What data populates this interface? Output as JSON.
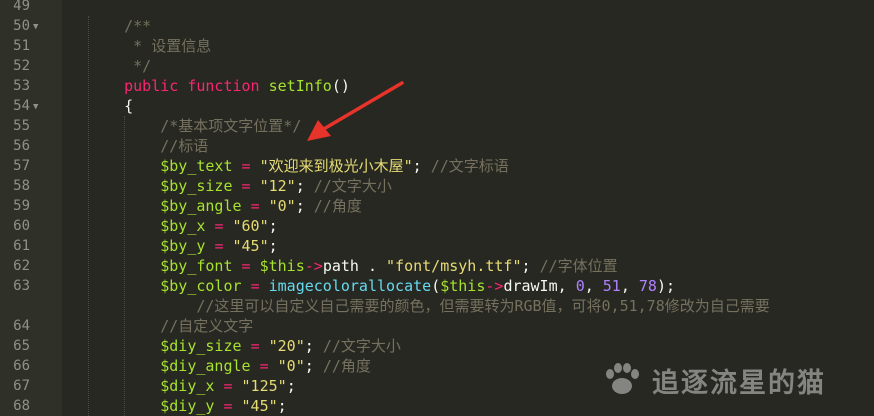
{
  "lines": [
    {
      "n": "49",
      "fold": false,
      "wrapped": false,
      "tokens": []
    },
    {
      "n": "50",
      "fold": true,
      "wrapped": false,
      "tokens": [
        {
          "t": "    "
        },
        {
          "t": "/**",
          "c": "comment"
        }
      ]
    },
    {
      "n": "51",
      "fold": false,
      "wrapped": false,
      "tokens": [
        {
          "t": "     "
        },
        {
          "t": "* 设置信息",
          "c": "comment"
        }
      ]
    },
    {
      "n": "52",
      "fold": false,
      "wrapped": false,
      "tokens": [
        {
          "t": "     "
        },
        {
          "t": "*/",
          "c": "comment"
        }
      ]
    },
    {
      "n": "53",
      "fold": false,
      "wrapped": false,
      "tokens": [
        {
          "t": "    "
        },
        {
          "t": "public",
          "c": "kw"
        },
        {
          "t": " "
        },
        {
          "t": "function",
          "c": "kw"
        },
        {
          "t": " "
        },
        {
          "t": "setInfo",
          "c": "fn"
        },
        {
          "t": "()"
        }
      ]
    },
    {
      "n": "54",
      "fold": true,
      "wrapped": false,
      "tokens": [
        {
          "t": "    {"
        }
      ]
    },
    {
      "n": "55",
      "fold": false,
      "wrapped": false,
      "tokens": [
        {
          "t": "        "
        },
        {
          "t": "/*基本项文字位置*/",
          "c": "comment"
        }
      ]
    },
    {
      "n": "56",
      "fold": false,
      "wrapped": false,
      "tokens": [
        {
          "t": "        "
        },
        {
          "t": "//标语",
          "c": "comment"
        }
      ]
    },
    {
      "n": "57",
      "fold": false,
      "wrapped": false,
      "tokens": [
        {
          "t": "        "
        },
        {
          "t": "$by_text",
          "c": "var"
        },
        {
          "t": " "
        },
        {
          "t": "=",
          "c": "op"
        },
        {
          "t": " "
        },
        {
          "t": "\"欢迎来到极光小木屋\"",
          "c": "str"
        },
        {
          "t": "; "
        },
        {
          "t": "//文字标语",
          "c": "comment"
        }
      ]
    },
    {
      "n": "58",
      "fold": false,
      "wrapped": false,
      "tokens": [
        {
          "t": "        "
        },
        {
          "t": "$by_size",
          "c": "var"
        },
        {
          "t": " "
        },
        {
          "t": "=",
          "c": "op"
        },
        {
          "t": " "
        },
        {
          "t": "\"12\"",
          "c": "str"
        },
        {
          "t": "; "
        },
        {
          "t": "//文字大小",
          "c": "comment"
        }
      ]
    },
    {
      "n": "59",
      "fold": false,
      "wrapped": false,
      "tokens": [
        {
          "t": "        "
        },
        {
          "t": "$by_angle",
          "c": "var"
        },
        {
          "t": " "
        },
        {
          "t": "=",
          "c": "op"
        },
        {
          "t": " "
        },
        {
          "t": "\"0\"",
          "c": "str"
        },
        {
          "t": "; "
        },
        {
          "t": "//角度",
          "c": "comment"
        }
      ]
    },
    {
      "n": "60",
      "fold": false,
      "wrapped": false,
      "tokens": [
        {
          "t": "        "
        },
        {
          "t": "$by_x",
          "c": "var"
        },
        {
          "t": " "
        },
        {
          "t": "=",
          "c": "op"
        },
        {
          "t": " "
        },
        {
          "t": "\"60\"",
          "c": "str"
        },
        {
          "t": ";"
        }
      ]
    },
    {
      "n": "61",
      "fold": false,
      "wrapped": false,
      "tokens": [
        {
          "t": "        "
        },
        {
          "t": "$by_y",
          "c": "var"
        },
        {
          "t": " "
        },
        {
          "t": "=",
          "c": "op"
        },
        {
          "t": " "
        },
        {
          "t": "\"45\"",
          "c": "str"
        },
        {
          "t": ";"
        }
      ]
    },
    {
      "n": "62",
      "fold": false,
      "wrapped": false,
      "tokens": [
        {
          "t": "        "
        },
        {
          "t": "$by_font",
          "c": "var"
        },
        {
          "t": " "
        },
        {
          "t": "=",
          "c": "op"
        },
        {
          "t": " "
        },
        {
          "t": "$this",
          "c": "var"
        },
        {
          "t": "->",
          "c": "op"
        },
        {
          "t": "path . "
        },
        {
          "t": "\"font/msyh.ttf\"",
          "c": "str"
        },
        {
          "t": "; "
        },
        {
          "t": "//字体位置",
          "c": "comment"
        }
      ]
    },
    {
      "n": "63",
      "fold": false,
      "wrapped": false,
      "tokens": [
        {
          "t": "        "
        },
        {
          "t": "$by_color",
          "c": "var"
        },
        {
          "t": " "
        },
        {
          "t": "=",
          "c": "op"
        },
        {
          "t": " "
        },
        {
          "t": "imagecolorallocate",
          "c": "bfn"
        },
        {
          "t": "("
        },
        {
          "t": "$this",
          "c": "var"
        },
        {
          "t": "->",
          "c": "op"
        },
        {
          "t": "drawIm, "
        },
        {
          "t": "0",
          "c": "num"
        },
        {
          "t": ", "
        },
        {
          "t": "51",
          "c": "num"
        },
        {
          "t": ", "
        },
        {
          "t": "78",
          "c": "num"
        },
        {
          "t": ");"
        }
      ]
    },
    {
      "n": "",
      "fold": false,
      "wrapped": true,
      "tokens": [
        {
          "t": "            "
        },
        {
          "t": "//这里可以自定义自己需要的颜色，但需要转为RGB值，可将0,51,78修改为自己需要",
          "c": "comment"
        }
      ]
    },
    {
      "n": "64",
      "fold": false,
      "wrapped": false,
      "tokens": [
        {
          "t": "        "
        },
        {
          "t": "//自定义文字",
          "c": "comment"
        }
      ]
    },
    {
      "n": "65",
      "fold": false,
      "wrapped": false,
      "tokens": [
        {
          "t": "        "
        },
        {
          "t": "$diy_size",
          "c": "var"
        },
        {
          "t": " "
        },
        {
          "t": "=",
          "c": "op"
        },
        {
          "t": " "
        },
        {
          "t": "\"20\"",
          "c": "str"
        },
        {
          "t": "; "
        },
        {
          "t": "//文字大小",
          "c": "comment"
        }
      ]
    },
    {
      "n": "66",
      "fold": false,
      "wrapped": false,
      "tokens": [
        {
          "t": "        "
        },
        {
          "t": "$diy_angle",
          "c": "var"
        },
        {
          "t": " "
        },
        {
          "t": "=",
          "c": "op"
        },
        {
          "t": " "
        },
        {
          "t": "\"0\"",
          "c": "str"
        },
        {
          "t": "; "
        },
        {
          "t": "//角度",
          "c": "comment"
        }
      ]
    },
    {
      "n": "67",
      "fold": false,
      "wrapped": false,
      "tokens": [
        {
          "t": "        "
        },
        {
          "t": "$diy_x",
          "c": "var"
        },
        {
          "t": " "
        },
        {
          "t": "=",
          "c": "op"
        },
        {
          "t": " "
        },
        {
          "t": "\"125\"",
          "c": "str"
        },
        {
          "t": ";"
        }
      ]
    },
    {
      "n": "68",
      "fold": false,
      "wrapped": false,
      "tokens": [
        {
          "t": "        "
        },
        {
          "t": "$diy_y",
          "c": "var"
        },
        {
          "t": " "
        },
        {
          "t": "=",
          "c": "op"
        },
        {
          "t": " "
        },
        {
          "t": "\"45\"",
          "c": "str"
        },
        {
          "t": ";"
        }
      ]
    }
  ],
  "annotation": {
    "color": "#E8332A",
    "icon": "arrow-icon"
  },
  "watermark": {
    "text": "追逐流星的猫",
    "icon": "cat-paw-icon"
  },
  "colors": {
    "background": "#272822",
    "gutter": "#2F3129",
    "comment": "#75715E",
    "keyword": "#F92672",
    "string": "#E6DB74",
    "number": "#AE81FF",
    "function": "#A6E22E",
    "builtin": "#66D9EF",
    "text": "#F8F8F2"
  }
}
